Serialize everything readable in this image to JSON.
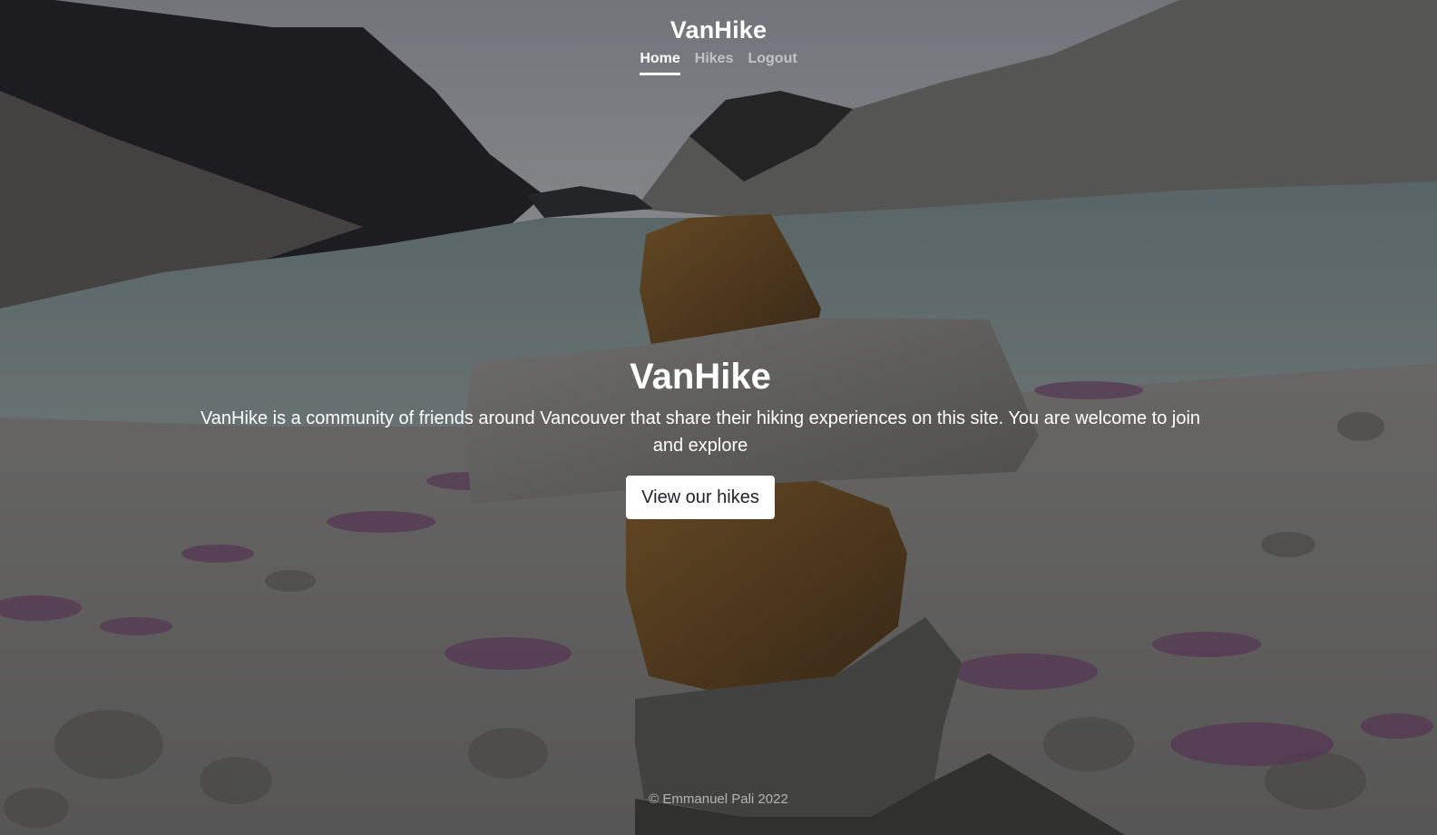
{
  "header": {
    "brand": "VanHike",
    "nav": [
      {
        "label": "Home",
        "active": true
      },
      {
        "label": "Hikes",
        "active": false
      },
      {
        "label": "Logout",
        "active": false
      }
    ]
  },
  "hero": {
    "title": "VanHike",
    "lead": "VanHike is a community of friends around Vancouver that share their hiking experiences on this site. You are welcome to join and explore",
    "button_label": "View our hikes"
  },
  "footer": {
    "copyright": "© Emmanuel Pali 2022"
  },
  "background": {
    "description_icon": "inukshuk-lake-mountain-photo"
  },
  "colors": {
    "overlay": "#000000",
    "button_bg": "#ffffff",
    "button_text": "#212529",
    "nav_inactive": "#bfbfbf",
    "nav_active": "#ffffff"
  }
}
